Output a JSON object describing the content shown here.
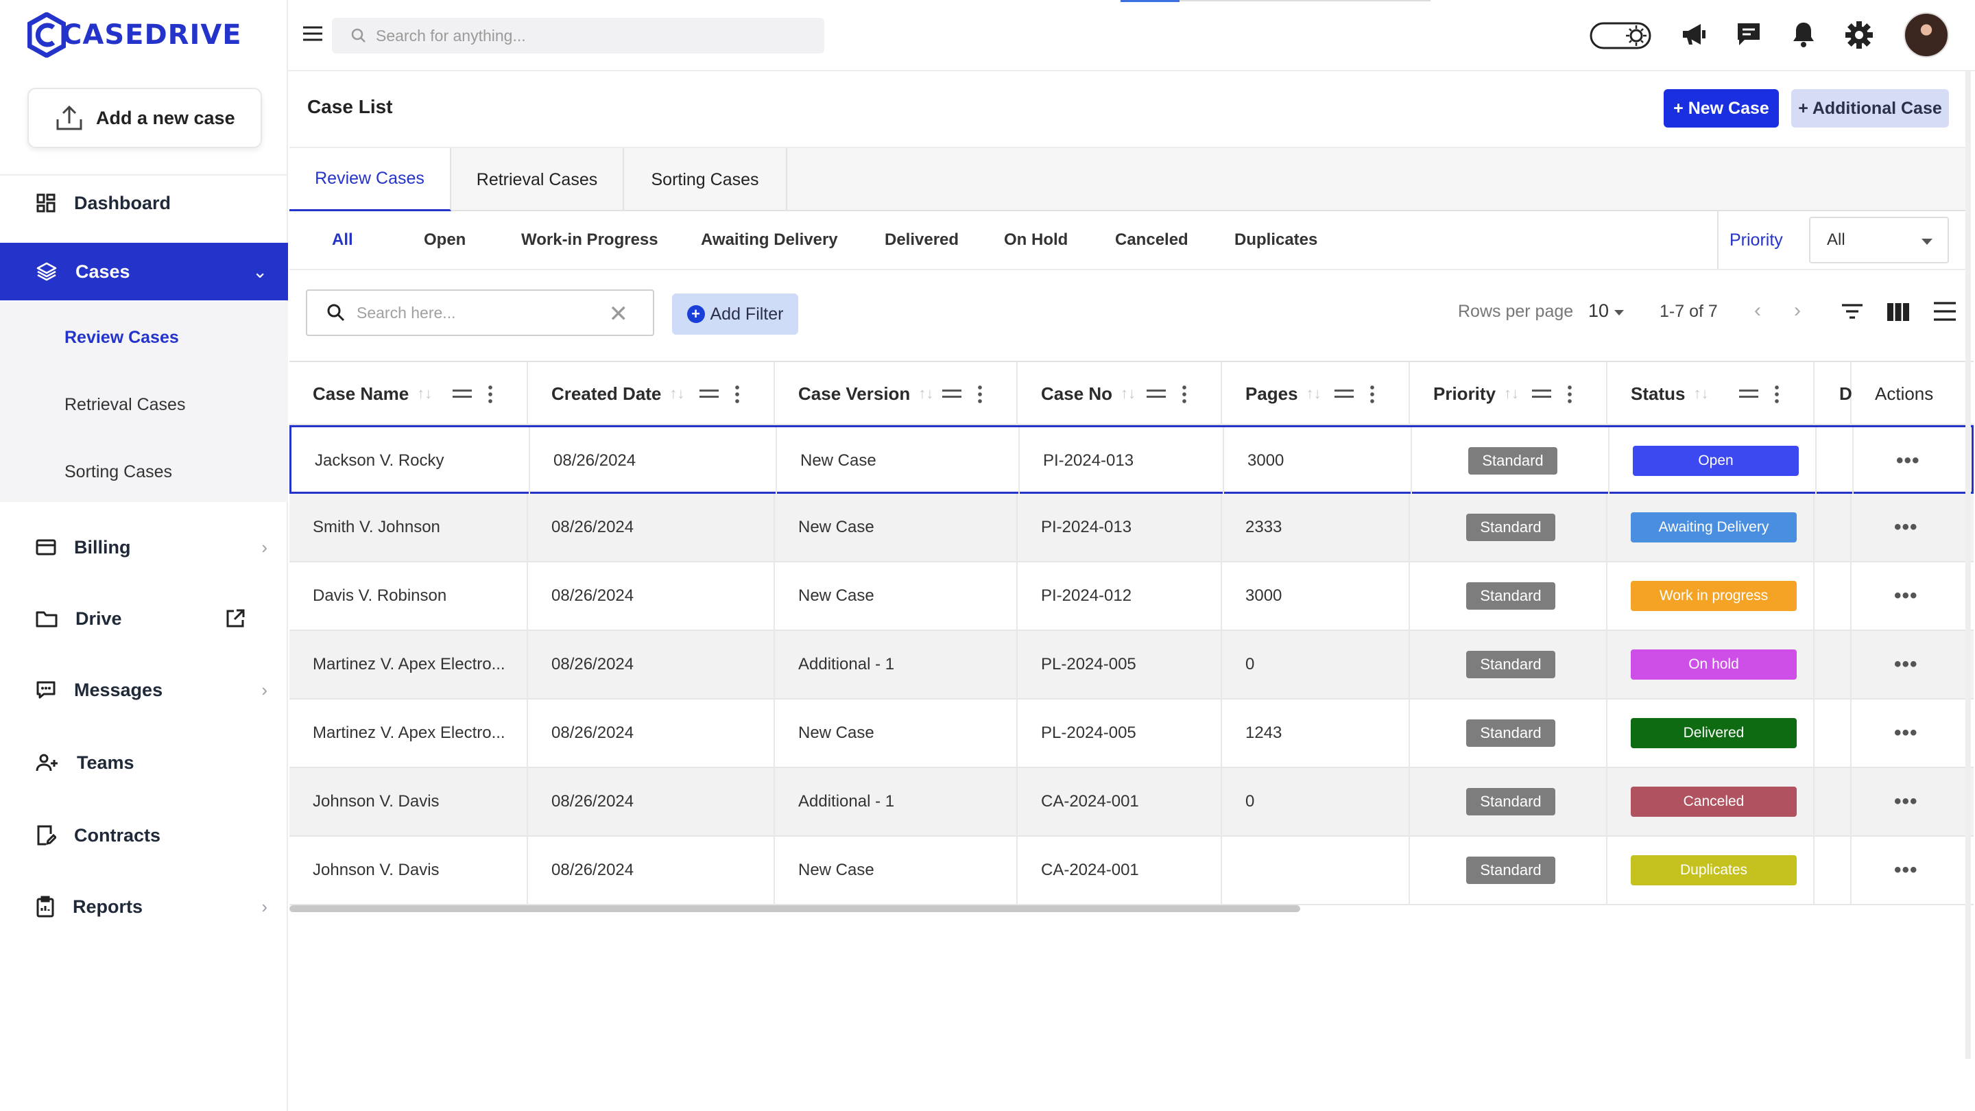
{
  "brand": {
    "name": "CASEDRIVE",
    "color": "#2433c9"
  },
  "sidebar": {
    "add_case": "Add a new case",
    "items": [
      {
        "label": "Dashboard",
        "icon": "dashboard-icon"
      },
      {
        "label": "Cases",
        "icon": "layers-icon",
        "active": true
      },
      {
        "label": "Billing",
        "icon": "card-icon"
      },
      {
        "label": "Drive",
        "icon": "folder-icon"
      },
      {
        "label": "Messages",
        "icon": "chat-icon"
      },
      {
        "label": "Teams",
        "icon": "team-icon"
      },
      {
        "label": "Contracts",
        "icon": "contract-icon"
      },
      {
        "label": "Reports",
        "icon": "clipboard-icon"
      }
    ],
    "sub_items": [
      "Review Cases",
      "Retrieval Cases",
      "Sorting Cases"
    ]
  },
  "topbar": {
    "search_placeholder": "Search for anything..."
  },
  "page": {
    "title": "Case List",
    "new_case_btn": "+ New Case",
    "additional_case_btn": "+ Additional Case",
    "tabs": [
      "Review Cases",
      "Retrieval Cases",
      "Sorting Cases"
    ],
    "filters": [
      "All",
      "Open",
      "Work-in Progress",
      "Awaiting Delivery",
      "Delivered",
      "On Hold",
      "Canceled",
      "Duplicates"
    ],
    "priority_label": "Priority",
    "priority_value": "All",
    "table_search_placeholder": "Search here...",
    "add_filter": "Add Filter",
    "rows_per_page_label": "Rows per page",
    "rows_per_page": "10",
    "range": "1-7 of 7"
  },
  "table": {
    "columns": [
      "Case Name",
      "Created Date",
      "Case Version",
      "Case No",
      "Pages",
      "Priority",
      "Status",
      "D",
      "Actions"
    ],
    "rows": [
      {
        "name": "Jackson V. Rocky",
        "date": "08/26/2024",
        "version": "New Case",
        "no": "PI-2024-013",
        "pages": "3000",
        "priority": "Standard",
        "status": "Open",
        "color": "#3d49f0"
      },
      {
        "name": "Smith V. Johnson",
        "date": "08/26/2024",
        "version": "New Case",
        "no": "PI-2024-013",
        "pages": "2333",
        "priority": "Standard",
        "status": "Awaiting Delivery",
        "color": "#4a8ee0"
      },
      {
        "name": "Davis V. Robinson",
        "date": "08/26/2024",
        "version": "New Case",
        "no": "PI-2024-012",
        "pages": "3000",
        "priority": "Standard",
        "status": "Work in progress",
        "color": "#f4a324"
      },
      {
        "name": "Martinez V. Apex Electro...",
        "date": "08/26/2024",
        "version": "Additional - 1",
        "no": "PL-2024-005",
        "pages": "0",
        "priority": "Standard",
        "status": "On hold",
        "color": "#cd4fe8"
      },
      {
        "name": "Martinez V. Apex Electro...",
        "date": "08/26/2024",
        "version": "New Case",
        "no": "PL-2024-005",
        "pages": "1243",
        "priority": "Standard",
        "status": "Delivered",
        "color": "#0e6b12"
      },
      {
        "name": "Johnson V. Davis",
        "date": "08/26/2024",
        "version": "Additional - 1",
        "no": "CA-2024-001",
        "pages": "0",
        "priority": "Standard",
        "status": "Canceled",
        "color": "#b05260"
      },
      {
        "name": "Johnson V. Davis",
        "date": "08/26/2024",
        "version": "New Case",
        "no": "CA-2024-001",
        "pages": "",
        "priority": "Standard",
        "status": "Duplicates",
        "color": "#c5c21f"
      }
    ]
  }
}
